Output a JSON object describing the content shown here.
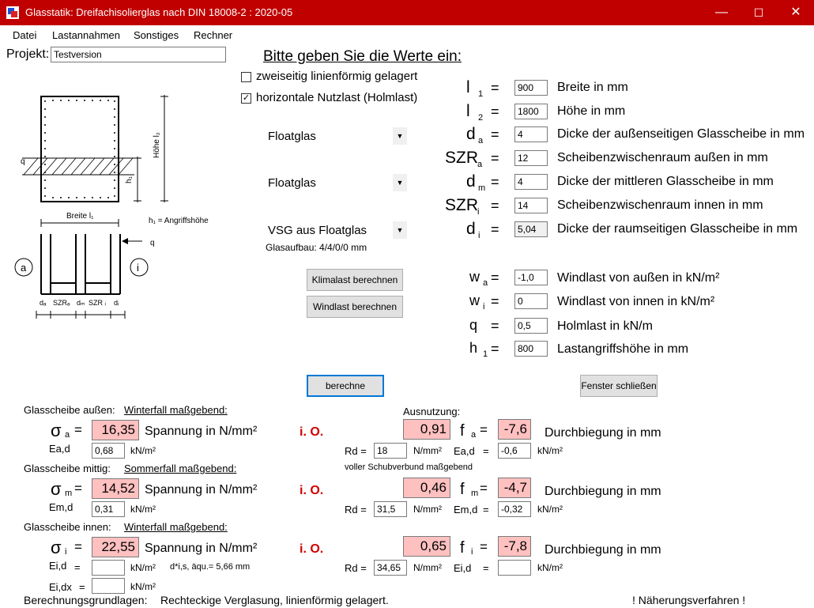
{
  "window": {
    "title": "Glasstatik: Dreifachisolierglas nach DIN 18008-2 : 2020-05",
    "minimize": "—",
    "maximize": "☐",
    "close": "✕",
    "titlebar_color": "#c00000"
  },
  "menu": [
    "Datei",
    "Lastannahmen",
    "Sonstiges",
    "Rechner"
  ],
  "projekt": {
    "label": "Projekt:",
    "value": "Testversion"
  },
  "heading": "Bitte geben Sie die Werte ein:",
  "options": [
    {
      "label": "zweiseitig linienförmig gelagert",
      "checked": false
    },
    {
      "label": "horizontale Nutzlast (Holmlast)",
      "checked": true
    }
  ],
  "glass": {
    "outer": "Floatglas",
    "middle": "Floatglas",
    "inner": "VSG aus Floatglas",
    "aufbau": "Glasaufbau: 4/4/0/0 mm"
  },
  "buttons": {
    "klimalast": "Klimalast berechnen",
    "windlast": "Windlast berechnen",
    "berechne": "berechne",
    "schliessen": "Fenster schließen"
  },
  "inputs": [
    {
      "sym": "l",
      "sub": "1",
      "value": "900",
      "desc": "Breite in mm",
      "readonly": false
    },
    {
      "sym": "l",
      "sub": "2",
      "value": "1800",
      "desc": "Höhe in mm",
      "readonly": false
    },
    {
      "sym": "d",
      "sub": "a",
      "value": "4",
      "desc": "Dicke der außenseitigen Glasscheibe in mm",
      "readonly": false
    },
    {
      "sym": "SZR",
      "sub": "a",
      "value": "12",
      "desc": "Scheibenzwischenraum außen in mm",
      "readonly": false
    },
    {
      "sym": "d",
      "sub": "m",
      "value": "4",
      "desc": "Dicke der mittleren Glasscheibe in mm",
      "readonly": false
    },
    {
      "sym": "SZR",
      "sub": "i",
      "value": "14",
      "desc": "Scheibenzwischenraum innen in mm",
      "readonly": false
    },
    {
      "sym": "d",
      "sub": "i",
      "value": "5,04",
      "desc": "Dicke der raumseitigen Glasscheibe in mm",
      "readonly": true
    }
  ],
  "loads": [
    {
      "sym": "w",
      "sub": "a",
      "value": "-1,0",
      "desc": "Windlast von außen in kN/m²"
    },
    {
      "sym": "w",
      "sub": "i",
      "value": "0",
      "desc": "Windlast von innen in kN/m²"
    },
    {
      "sym": "q",
      "sub": "",
      "value": "0,5",
      "desc": "Holmlast in kN/m"
    },
    {
      "sym": "h",
      "sub": "1",
      "value": "800",
      "desc": "Lastangriffshöhe in mm"
    }
  ],
  "diagram": {
    "hoehe": "Höhe l₂",
    "breite": "Breite l₁",
    "h1": "h₁",
    "h1_text": "h₁ = Angriffshöhe",
    "q": "q",
    "a": "a",
    "i": "i",
    "dims": [
      "dₐ",
      "SZRₐ",
      "dₘ",
      "SZR ᵢ",
      "dᵢ"
    ]
  },
  "results": {
    "ausnutzung_label": "Ausnutzung:",
    "io": "i. O.",
    "spannung": "Spannung in N/mm²",
    "durchbiegung": "Durchbiegung in mm",
    "unit_kn": "kN/m²",
    "unit_nmm": "N/mm²",
    "rd_label": "Rd =",
    "schubverbund": "voller Schubverbund maßgebend",
    "panes": [
      {
        "title": "Glasscheibe außen:",
        "case": "Winterfall maßgebend:",
        "sym": "σ",
        "sub": "a",
        "sigma": "16,35",
        "ausnutzung": "0,91",
        "fsym": "f",
        "fsub": "a",
        "f": "-7,6",
        "e_label": "Ea,d",
        "e_value": "0,68",
        "rd": "18",
        "e2_label": "Ea,d",
        "e2_value": "-0,6"
      },
      {
        "title": "Glasscheibe mittig:",
        "case": "Sommerfall maßgebend:",
        "sym": "σ",
        "sub": "m",
        "sigma": "14,52",
        "ausnutzung": "0,46",
        "fsym": "f",
        "fsub": "m",
        "f": "-4,7",
        "e_label": "Em,d",
        "e_value": "0,31",
        "rd": "31,5",
        "e2_label": "Em,d",
        "e2_value": "-0,32"
      },
      {
        "title": "Glasscheibe innen:",
        "case": "Winterfall maßgebend:",
        "sym": "σ",
        "sub": "i",
        "sigma": "22,55",
        "ausnutzung": "0,65",
        "fsym": "f",
        "fsub": "i",
        "f": "-7,8",
        "e_label": "Ei,d",
        "e_value": "",
        "rd": "34,65",
        "e2_label": "Ei,d",
        "e2_value": ""
      }
    ],
    "aequiv": "d*i,s, äqu.= 5,66 mm",
    "eidx_label": "Ei,dx",
    "eidx_value": ""
  },
  "footer": {
    "grundlagen_label": "Berechnungsgrundlagen:",
    "grundlagen_text": "Rechteckige Verglasung, linienförmig gelagert.",
    "note": "! Näherungsverfahren !"
  }
}
